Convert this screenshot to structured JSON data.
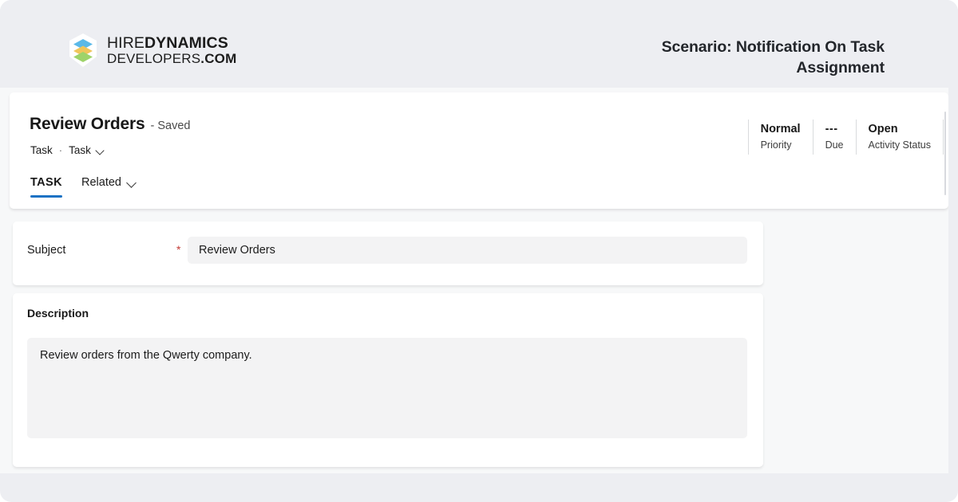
{
  "brand": {
    "logo_line1_light": "HIRE",
    "logo_line1_bold": "DYNAMICS",
    "logo_line2_light": "DEVELOPERS",
    "logo_line2_bold": ".COM",
    "logo_icon": "stacked-layers-icon",
    "layer_colors": [
      "#5bb9e8",
      "#f0c55a",
      "#9ed36a"
    ]
  },
  "scenario": {
    "text": "Scenario: Notification On Task Assignment"
  },
  "record": {
    "title": "Review Orders",
    "save_state": "- Saved",
    "breadcrumb_object": "Task",
    "breadcrumb_separator": "·",
    "breadcrumb_record_type": "Task",
    "highlights": [
      {
        "value": "Normal",
        "label": "Priority"
      },
      {
        "value": "---",
        "label": "Due"
      },
      {
        "value": "Open",
        "label": "Activity Status"
      }
    ]
  },
  "tabs": [
    {
      "label": "TASK",
      "active": true
    },
    {
      "label": "Related",
      "active": false
    }
  ],
  "fields": {
    "subject": {
      "label": "Subject",
      "required_marker": "*",
      "value": "Review Orders"
    },
    "description": {
      "label": "Description",
      "value": "Review orders from the Qwerty company."
    }
  },
  "colors": {
    "page_bg": "#edeef2",
    "app_bg": "#f7f8f9",
    "card_bg": "#ffffff",
    "input_bg": "#f3f3f4",
    "accent_blue": "#1b72c4",
    "required_red": "#c23934"
  }
}
